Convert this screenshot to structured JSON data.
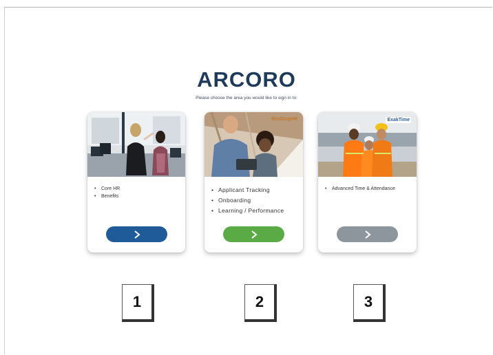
{
  "logo": "ARCORO",
  "subtitle": "Please choose the area you would like to sign in to:",
  "cards": [
    {
      "features": [
        "Core HR",
        "Benefits"
      ],
      "button_color": "#1f5b98",
      "badge": ""
    },
    {
      "features": [
        "Applicant Tracking",
        "Onboarding",
        "Learning / Performance"
      ],
      "button_color": "#5aaa45",
      "badge": "BirdDogHR"
    },
    {
      "features": [
        "Advanced Time & Attendance"
      ],
      "button_color": "#8e969d",
      "badge": "ExakTime"
    }
  ],
  "icons": {
    "button": "chevron-right-icon"
  },
  "labels": [
    "1",
    "2",
    "3"
  ]
}
